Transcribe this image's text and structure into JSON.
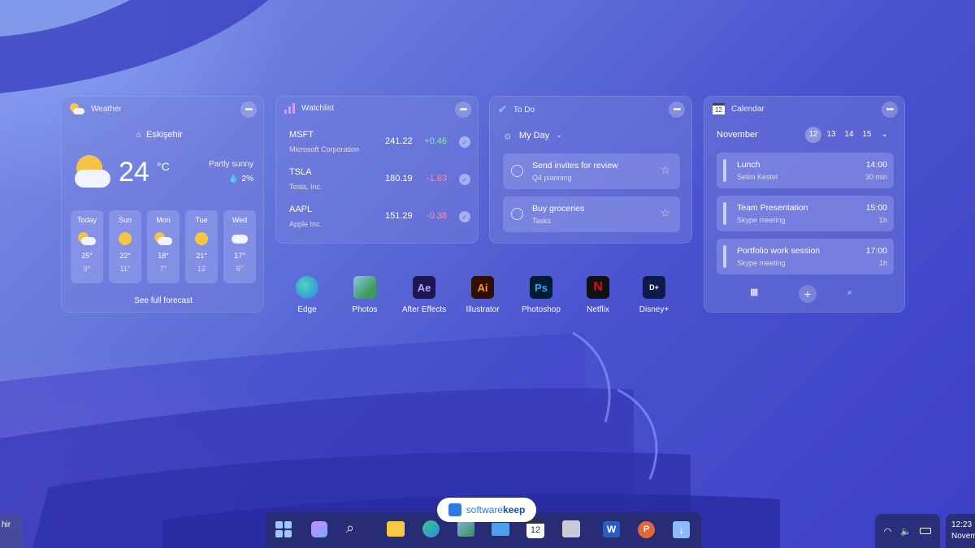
{
  "weather": {
    "title": "Weather",
    "location": "Eskişehir",
    "temp": "24",
    "unit": "°C",
    "condition": "Partly sunny",
    "precip": "2%",
    "days": [
      {
        "name": "Today",
        "icon": "partly-sunny",
        "high": "25°",
        "low": "9°"
      },
      {
        "name": "Sun",
        "icon": "sunny",
        "high": "22°",
        "low": "11°"
      },
      {
        "name": "Mon",
        "icon": "partly-sunny",
        "high": "18°",
        "low": "7°"
      },
      {
        "name": "Tue",
        "icon": "sunny",
        "high": "21°",
        "low": "12"
      },
      {
        "name": "Wed",
        "icon": "cloudy",
        "high": "17°",
        "low": "6°"
      }
    ],
    "forecast_link": "See full forecast"
  },
  "watchlist": {
    "title": "Watchlist",
    "stocks": [
      {
        "ticker": "MSFT",
        "name": "Microsoft Corporation",
        "price": "241.22",
        "change": "+0.46",
        "color": "#7ff0b5"
      },
      {
        "ticker": "TSLA",
        "name": "Tesla, Inc.",
        "price": "180.19",
        "change": "-1.63",
        "color": "#ff8da6"
      },
      {
        "ticker": "AAPL",
        "name": "Apple Inc.",
        "price": "151.29",
        "change": "-0.38",
        "color": "#ff8da6"
      }
    ]
  },
  "todo": {
    "title": "To Do",
    "list": "My Day",
    "tasks": [
      {
        "title": "Send invites for review",
        "sub": "Q4 planning"
      },
      {
        "title": "Buy groceries",
        "sub": "Tasks"
      }
    ]
  },
  "calendar": {
    "title": "Calendar",
    "icon_day": "12",
    "month": "November",
    "days": [
      "12",
      "13",
      "14",
      "15"
    ],
    "events": [
      {
        "title": "Lunch",
        "sub": "Selim Kestel",
        "time": "14:00",
        "dur": "30 min"
      },
      {
        "title": "Team Presentation",
        "sub": "Skype meeting",
        "time": "15:00",
        "dur": "1h"
      },
      {
        "title": "Portfolio work session",
        "sub": "Skype meeting",
        "time": "17:00",
        "dur": "1h"
      }
    ]
  },
  "apps": [
    {
      "label": "Edge",
      "icon": "edge-icon",
      "glyph": "e"
    },
    {
      "label": "Photos",
      "icon": "photos-icon",
      "glyph": ""
    },
    {
      "label": "After Effects",
      "icon": "after-effects-icon",
      "glyph": "Ae"
    },
    {
      "label": "Illustrator",
      "icon": "illustrator-icon",
      "glyph": "Ai"
    },
    {
      "label": "Photoshop",
      "icon": "photoshop-icon",
      "glyph": "Ps"
    },
    {
      "label": "Netflix",
      "icon": "netflix-icon",
      "glyph": "N"
    },
    {
      "label": "Disney+",
      "icon": "disney-plus-icon",
      "glyph": "D+"
    }
  ],
  "watermark": {
    "text_plain": "software",
    "text_bold": "keep"
  },
  "taskbar": {
    "left_text": "hir",
    "clock_time": "12:23",
    "clock_date": "Novem"
  }
}
